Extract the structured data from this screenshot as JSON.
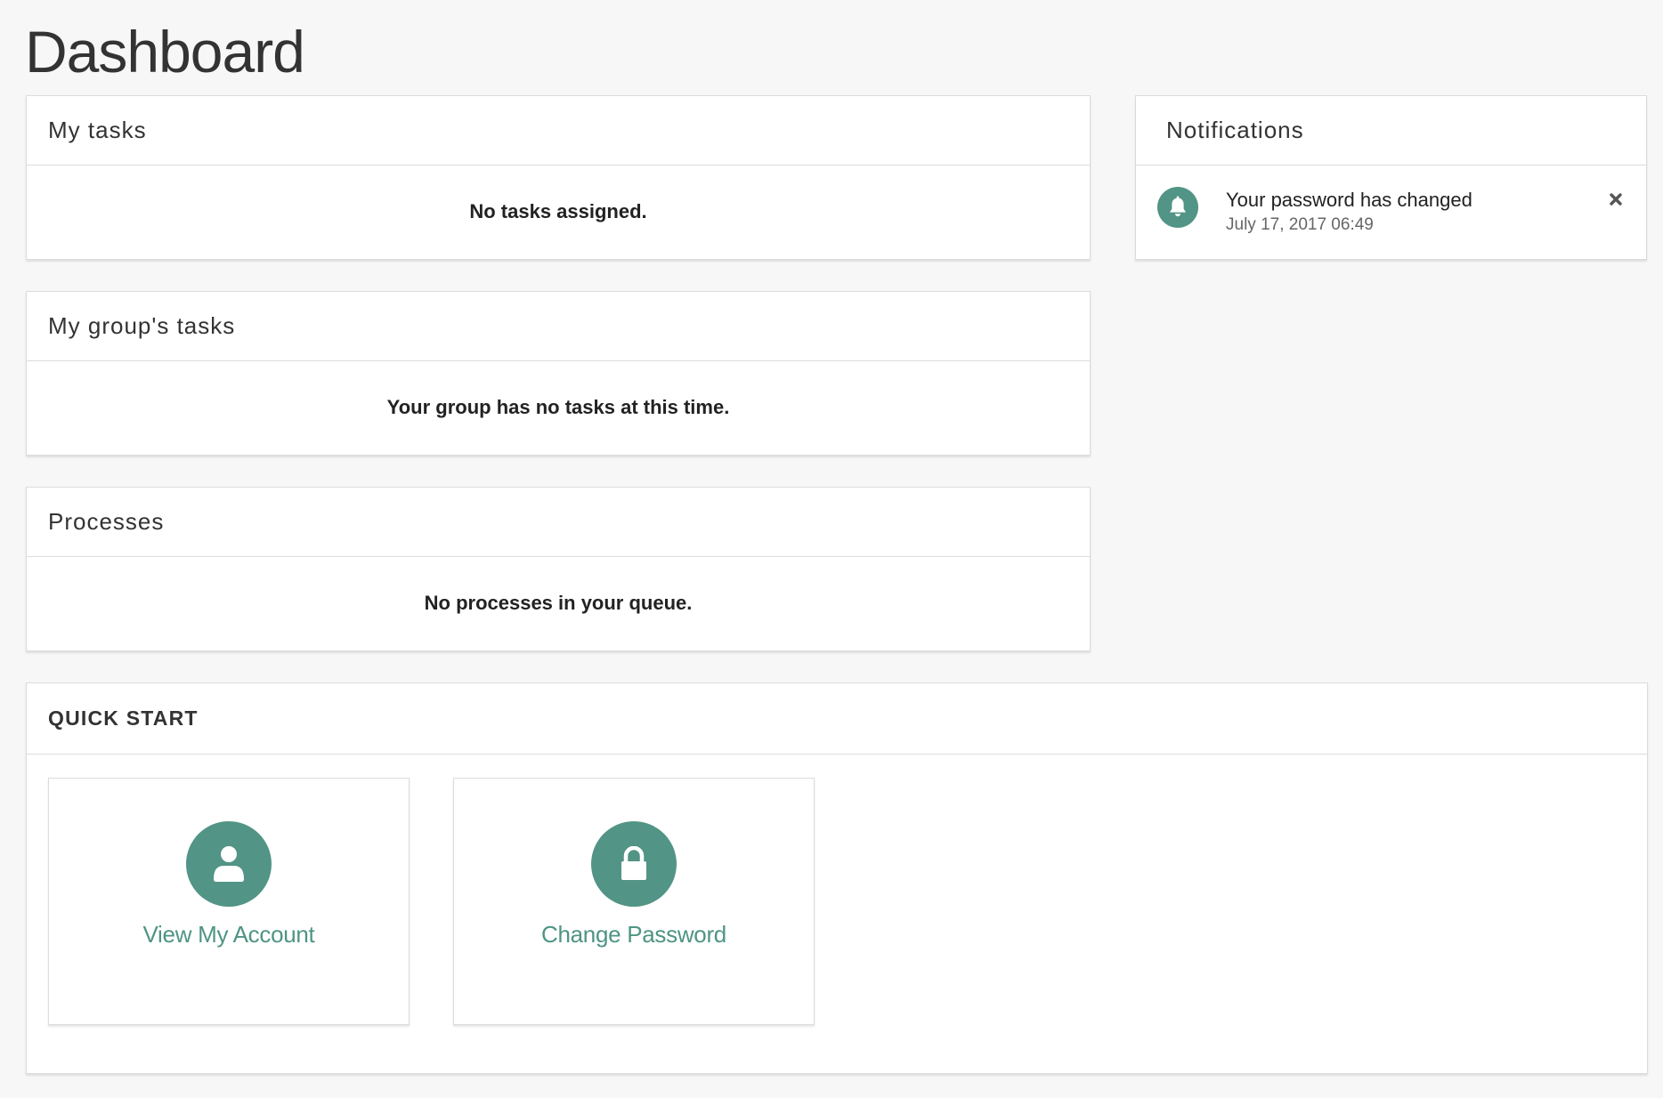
{
  "page": {
    "title": "Dashboard"
  },
  "my_tasks": {
    "title": "My tasks",
    "empty_message": "No tasks assigned."
  },
  "group_tasks": {
    "title": "My group's tasks",
    "empty_message": "Your group has no tasks at this time."
  },
  "processes": {
    "title": "Processes",
    "empty_message": "No processes in your queue."
  },
  "notifications": {
    "title": "Notifications",
    "items": [
      {
        "icon": "bell-icon",
        "title": "Your password has changed",
        "timestamp": "July 17, 2017 06:49",
        "close_icon": "close-icon"
      }
    ]
  },
  "quick_start": {
    "title": "QUICK START",
    "items": [
      {
        "label": "View My Account",
        "icon": "user-icon"
      },
      {
        "label": "Change Password",
        "icon": "lock-icon"
      }
    ]
  },
  "colors": {
    "accent": "#529485",
    "link": "#4e9484",
    "background": "#f7f7f7",
    "panel": "#ffffff",
    "border": "#dcdcdc"
  }
}
